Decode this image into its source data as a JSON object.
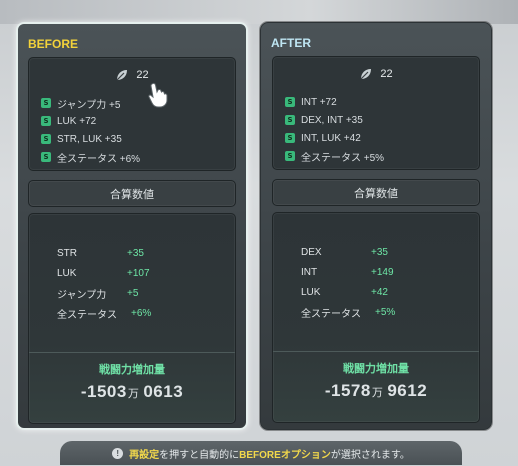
{
  "before": {
    "title": "BEFORE",
    "level": "22",
    "options": [
      {
        "grade": "S",
        "text": "ジャンプ力 +5"
      },
      {
        "grade": "S",
        "text": "LUK +72"
      },
      {
        "grade": "S",
        "text": "STR, LUK +35"
      },
      {
        "grade": "S",
        "text": "全ステータス +6%"
      }
    ],
    "sum_label": "合算数値",
    "stats": [
      {
        "name": "STR",
        "value": "+35"
      },
      {
        "name": "LUK",
        "value": "+107"
      },
      {
        "name": "ジャンプ力",
        "value": "+5"
      },
      {
        "name": "全ステータス",
        "value": "+6%"
      }
    ],
    "power_label": "戦闘力増加量",
    "power_main": "-1503",
    "power_unit": "万",
    "power_sub": "0613"
  },
  "after": {
    "title": "AFTER",
    "level": "22",
    "options": [
      {
        "grade": "S",
        "text": "INT +72"
      },
      {
        "grade": "S",
        "text": "DEX, INT +35"
      },
      {
        "grade": "S",
        "text": "INT, LUK +42"
      },
      {
        "grade": "S",
        "text": "全ステータス +5%"
      }
    ],
    "sum_label": "合算数値",
    "stats": [
      {
        "name": "DEX",
        "value": "+35"
      },
      {
        "name": "INT",
        "value": "+149"
      },
      {
        "name": "LUK",
        "value": "+42"
      },
      {
        "name": "全ステータス",
        "value": "+5%"
      }
    ],
    "power_label": "戦闘力増加量",
    "power_main": "-1578",
    "power_unit": "万",
    "power_sub": "9612"
  },
  "notice": {
    "icon": "info-icon",
    "icon_glyph": "!",
    "part1": "再設定",
    "part2": "を押すと自動的に",
    "part3": "BEFOREオプション",
    "part4": "が選択されます。"
  },
  "icons": {
    "level": "leaf-icon",
    "cursor": "hand-cursor-icon"
  },
  "colors": {
    "before_title": "#f3d23a",
    "after_title": "#bfe6f3",
    "stat_value": "#6ee6a6",
    "grade": "#39b97b"
  }
}
